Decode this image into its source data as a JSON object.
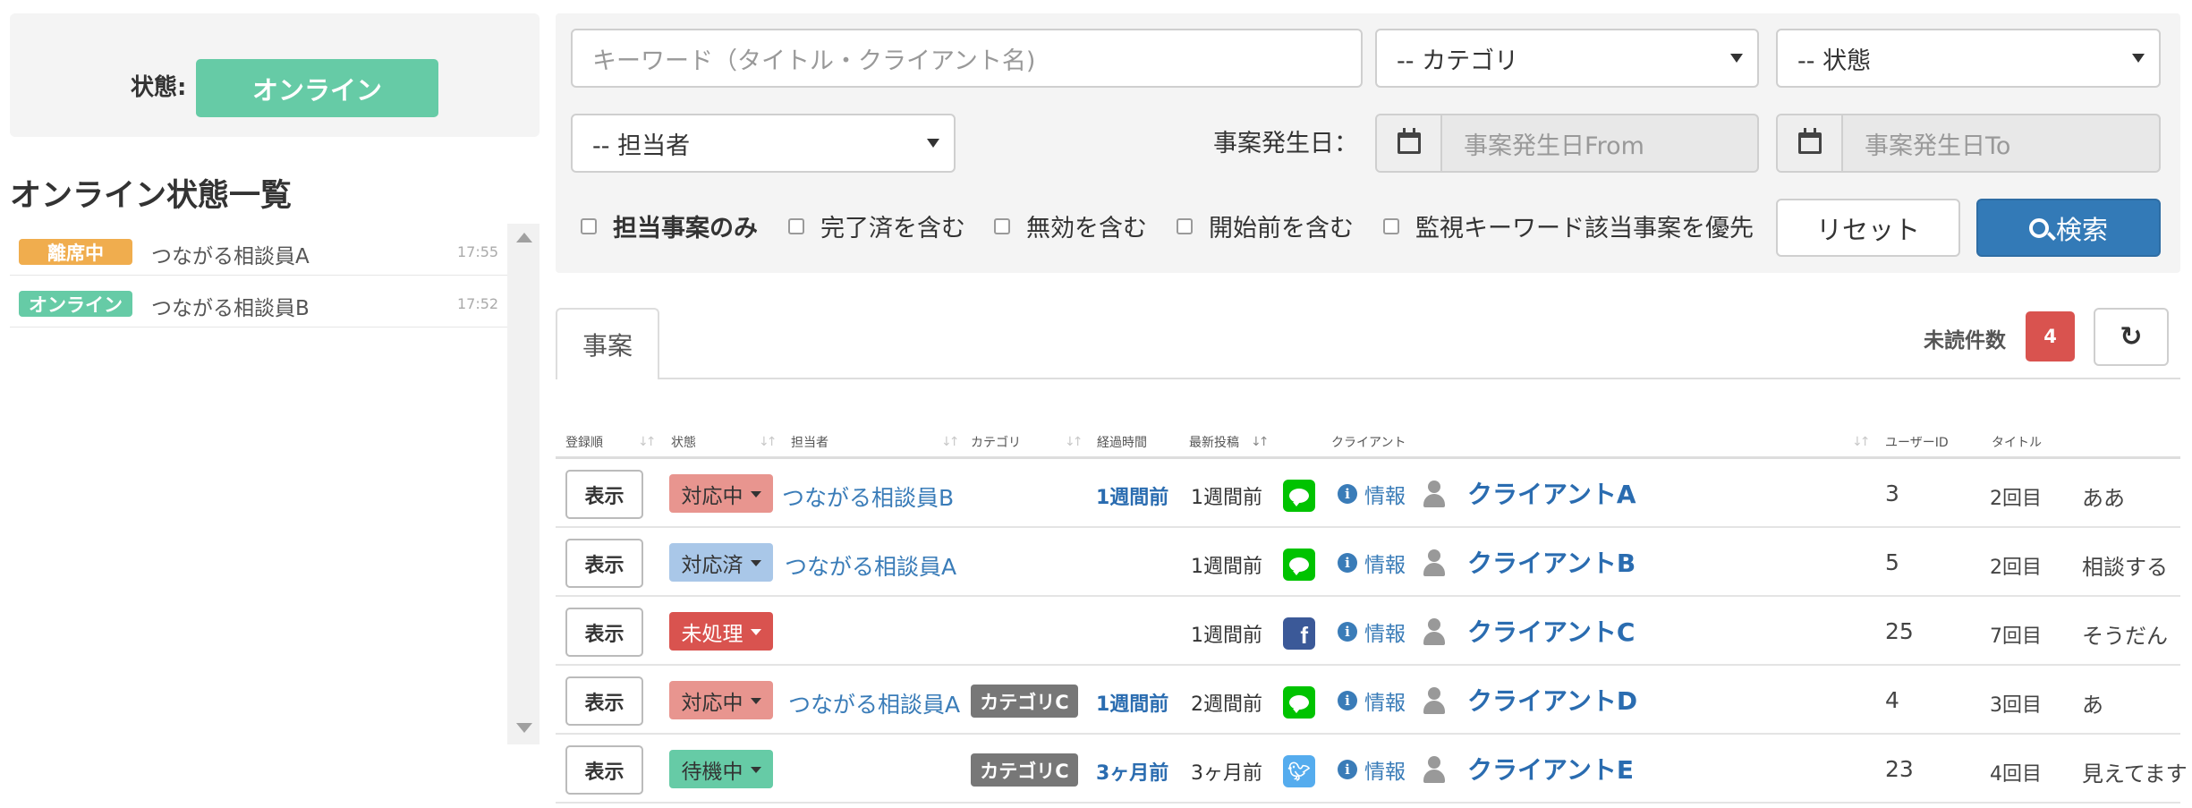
{
  "status_panel": {
    "label": "状態:",
    "value": "オンライン"
  },
  "online_list": {
    "title": "オンライン状態一覧",
    "items": [
      {
        "badge": "離席中",
        "badge_color": "#f0ad4e",
        "name": "つながる相談員A",
        "time": "17:55"
      },
      {
        "badge": "オンライン",
        "badge_color": "#66cba6",
        "name": "つながる相談員B",
        "time": "17:52"
      }
    ]
  },
  "search": {
    "keyword_placeholder": "キーワード（タイトル・クライアント名)",
    "category_select": "-- カテゴリ",
    "state_select": "-- 状態",
    "assignee_select": "-- 担当者",
    "date_label": "事案発生日：",
    "date_from_placeholder": "事案発生日From",
    "date_to_placeholder": "事案発生日To",
    "checkboxes": [
      "担当事案のみ",
      "完了済を含む",
      "無効を含む",
      "開始前を含む",
      "監視キーワード該当事案を優先"
    ],
    "reset_label": "リセット",
    "search_label": "検索"
  },
  "tabs": {
    "active": "事案"
  },
  "unread": {
    "label": "未読件数",
    "count": "4"
  },
  "table": {
    "headers": [
      "登録順",
      "状態",
      "担当者",
      "カテゴリ",
      "経過時間",
      "最新投稿",
      "クライアント",
      "ユーザーID",
      "タイトル"
    ],
    "view_label": "表示",
    "info_label": "情報",
    "rows": [
      {
        "status": "対応中",
        "status_bg": "#e8958f",
        "status_color": "#333333",
        "assignee": "つながる相談員B",
        "category": "",
        "elapsed": "1週間前",
        "latest": "1週間前",
        "channel": "LINE",
        "channel_color": "#00c300",
        "client": "クライアントA",
        "user_id": "3",
        "count": "2回目",
        "title": "ああ"
      },
      {
        "status": "対応済",
        "status_bg": "#a9c7e8",
        "status_color": "#333333",
        "assignee": "つながる相談員A",
        "category": "",
        "elapsed": "",
        "latest": "1週間前",
        "channel": "LINE",
        "channel_color": "#00c300",
        "client": "クライアントB",
        "user_id": "5",
        "count": "2回目",
        "title": "相談する"
      },
      {
        "status": "未処理",
        "status_bg": "#d9534f",
        "status_color": "#ffffff",
        "assignee": "",
        "category": "",
        "elapsed": "",
        "latest": "1週間前",
        "channel": "f",
        "channel_color": "#3b5998",
        "client": "クライアントC",
        "user_id": "25",
        "count": "7回目",
        "title": "そうだん"
      },
      {
        "status": "対応中",
        "status_bg": "#e8958f",
        "status_color": "#333333",
        "assignee": "つながる相談員A",
        "category": "カテゴリC",
        "elapsed": "1週間前",
        "latest": "2週間前",
        "channel": "LINE",
        "channel_color": "#00c300",
        "client": "クライアントD",
        "user_id": "4",
        "count": "3回目",
        "title": "あ"
      },
      {
        "status": "待機中",
        "status_bg": "#66cba6",
        "status_color": "#333333",
        "assignee": "",
        "category": "カテゴリC",
        "elapsed": "3ヶ月前",
        "latest": "3ヶ月前",
        "channel": "twitter",
        "channel_color": "#55acee",
        "client": "クライアントE",
        "user_id": "23",
        "count": "4回目",
        "title": "見えてます"
      }
    ]
  }
}
